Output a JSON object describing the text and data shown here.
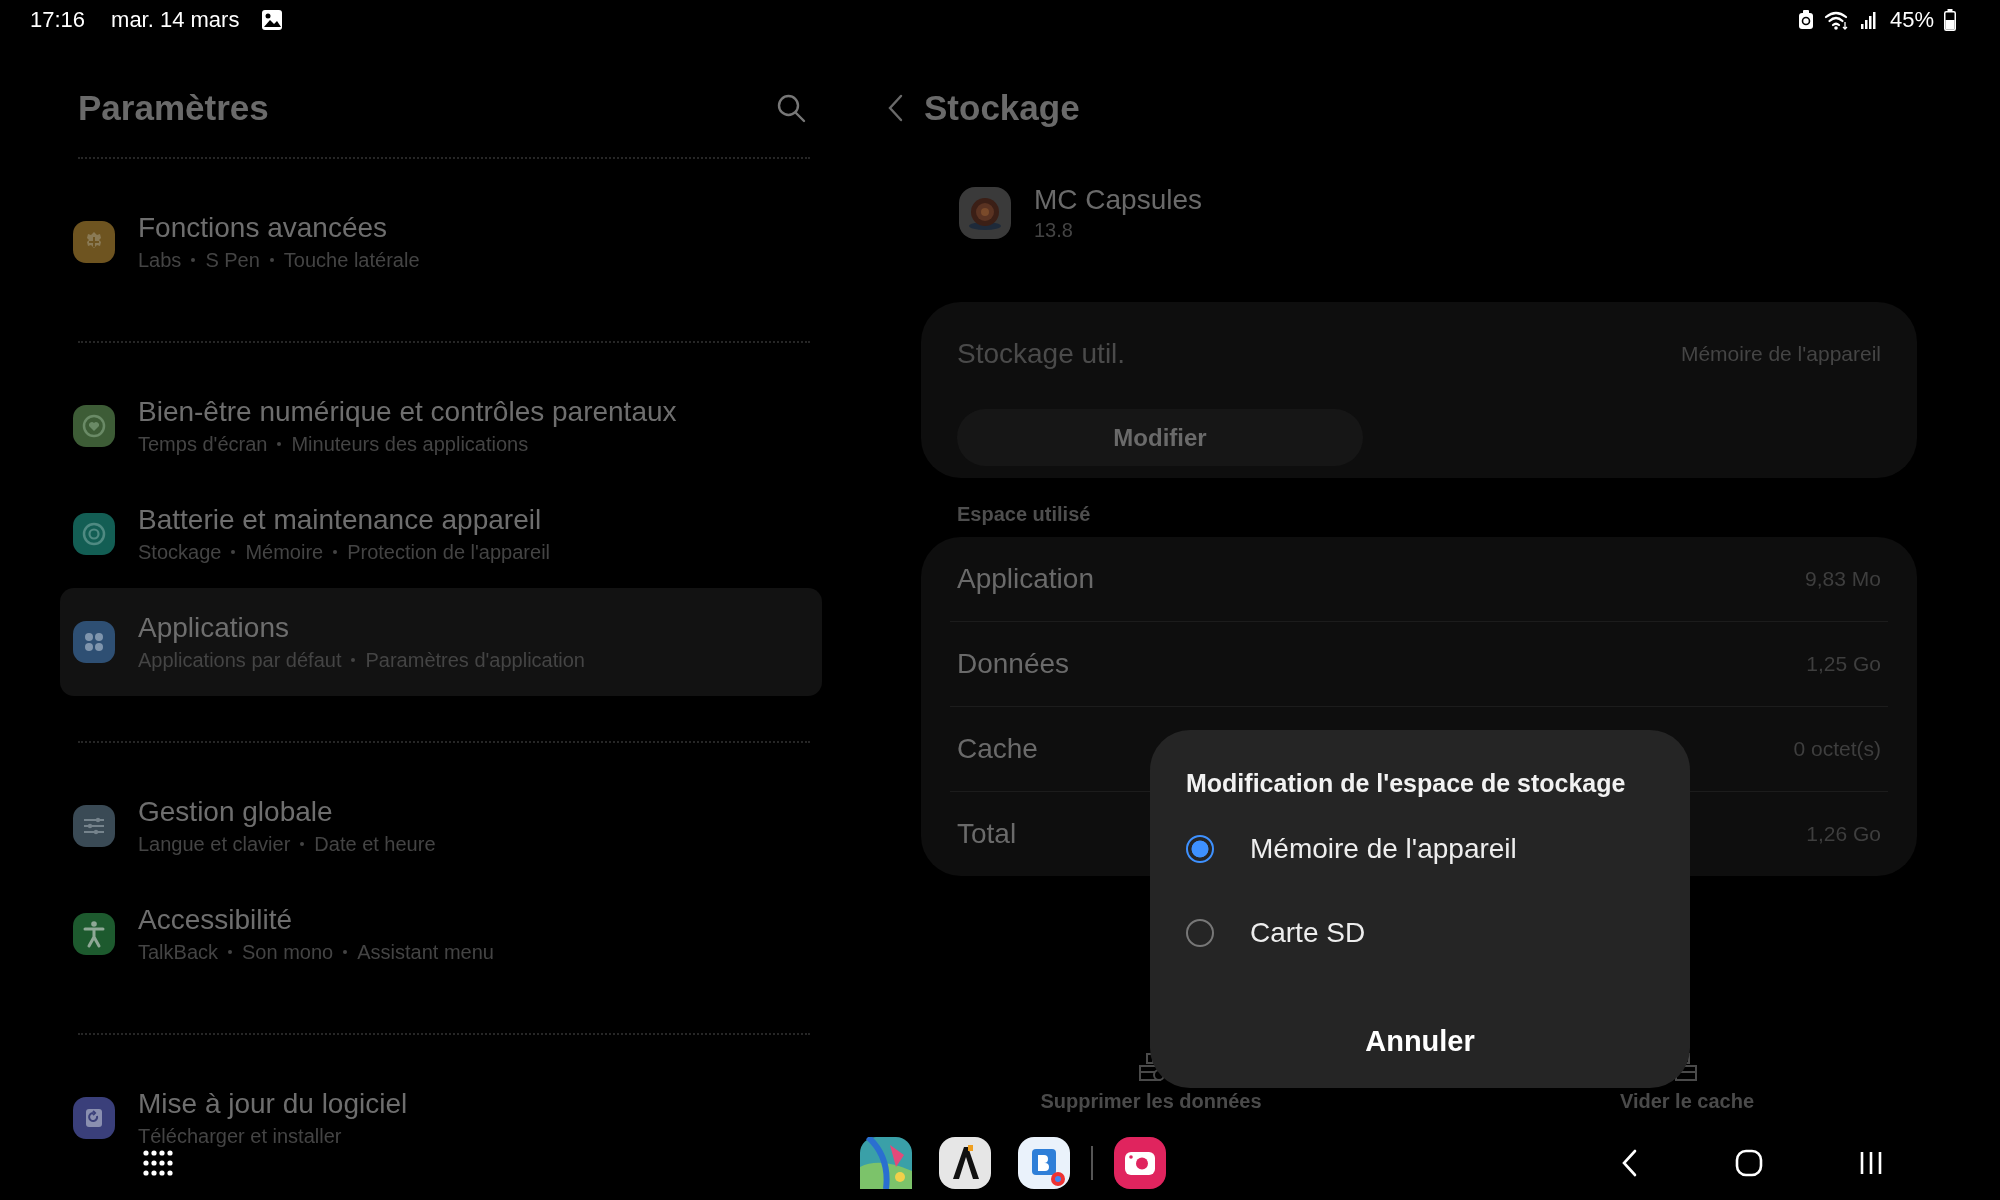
{
  "status_bar": {
    "time": "17:16",
    "date": "mar. 14 mars",
    "battery": "45%"
  },
  "settings": {
    "title": "Paramètres",
    "groups": [
      [
        {
          "title": "Fonctions avancées",
          "subtitle": [
            "Labs",
            "S Pen",
            "Touche latérale"
          ],
          "color": "#6e5420",
          "selected": false
        }
      ],
      [
        {
          "title": "Bien-être numérique et contrôles parentaux",
          "subtitle": [
            "Temps d'écran",
            "Minuteurs des applications"
          ],
          "color": "#3d5c36",
          "selected": false
        },
        {
          "title": "Batterie et maintenance appareil",
          "subtitle": [
            "Stockage",
            "Mémoire",
            "Protection de l'appareil"
          ],
          "color": "#135e54",
          "selected": false
        },
        {
          "title": "Applications",
          "subtitle": [
            "Applications par défaut",
            "Paramètres d'application"
          ],
          "color": "#2e4f73",
          "selected": true
        }
      ],
      [
        {
          "title": "Gestion globale",
          "subtitle": [
            "Langue et clavier",
            "Date et heure"
          ],
          "color": "#3a4a55",
          "selected": false
        },
        {
          "title": "Accessibilité",
          "subtitle": [
            "TalkBack",
            "Son mono",
            "Assistant menu"
          ],
          "color": "#1d5a2e",
          "selected": false
        }
      ],
      [
        {
          "title": "Mise à jour du logiciel",
          "subtitle": [
            "Télécharger et installer"
          ],
          "color": "#3a3f7a",
          "selected": false
        }
      ]
    ]
  },
  "storage": {
    "title": "Stockage",
    "app": {
      "name": "MC Capsules",
      "version": "13.8"
    },
    "location": {
      "label": "Stockage util.",
      "value": "Mémoire de l'appareil",
      "button": "Modifier"
    },
    "used_space": {
      "heading": "Espace utilisé",
      "rows": [
        {
          "label": "Application",
          "value": "9,83 Mo"
        },
        {
          "label": "Données",
          "value": "1,25 Go"
        },
        {
          "label": "Cache",
          "value": "0 octet(s)"
        },
        {
          "label": "Total",
          "value": "1,26 Go"
        }
      ]
    },
    "actions": [
      {
        "label": "Supprimer les données"
      },
      {
        "label": "Vider le cache"
      }
    ]
  },
  "dialog": {
    "title": "Modification de l'espace de stockage",
    "options": [
      {
        "label": "Mémoire de l'appareil",
        "selected": true
      },
      {
        "label": "Carte SD",
        "selected": false
      }
    ],
    "cancel": "Annuler"
  }
}
